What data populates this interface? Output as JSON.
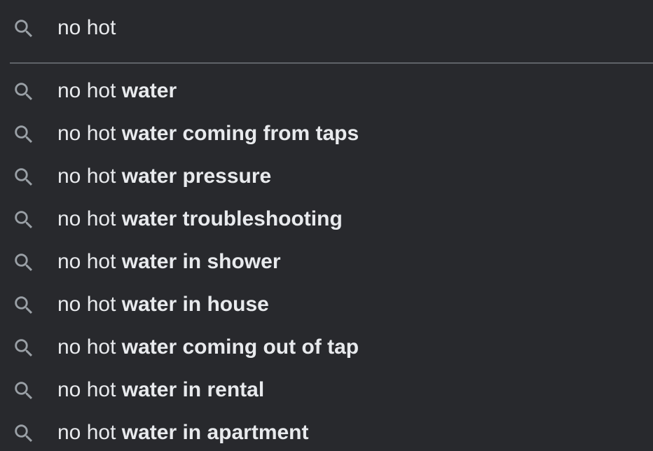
{
  "search": {
    "value": "no hot",
    "icon": "search-icon"
  },
  "suggestions": [
    {
      "prefix": "no hot",
      "completion": "water",
      "icon": "search-icon"
    },
    {
      "prefix": "no hot",
      "completion": "water coming from taps",
      "icon": "search-icon"
    },
    {
      "prefix": "no hot",
      "completion": "water pressure",
      "icon": "search-icon"
    },
    {
      "prefix": "no hot",
      "completion": "water troubleshooting",
      "icon": "search-icon"
    },
    {
      "prefix": "no hot",
      "completion": "water in shower",
      "icon": "search-icon"
    },
    {
      "prefix": "no hot",
      "completion": "water in house",
      "icon": "search-icon"
    },
    {
      "prefix": "no hot",
      "completion": "water coming out of tap",
      "icon": "search-icon"
    },
    {
      "prefix": "no hot",
      "completion": "water in rental",
      "icon": "search-icon"
    },
    {
      "prefix": "no hot",
      "completion": "water in apartment",
      "icon": "search-icon"
    }
  ],
  "colors": {
    "background": "#28292d",
    "text": "#e8eaed",
    "icon": "#9aa0a6",
    "divider": "#5f6368"
  }
}
